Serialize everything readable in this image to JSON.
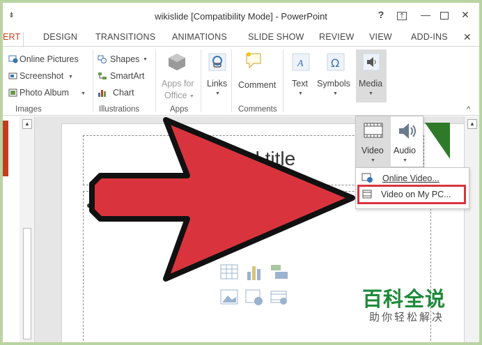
{
  "window": {
    "title": "wikislide [Compatibility Mode] - PowerPoint",
    "help": "?",
    "ribbon_options": "⤒",
    "minimize": "—",
    "close": "✕",
    "qat": "⇟"
  },
  "tabs": [
    "ERT",
    "DESIGN",
    "TRANSITIONS",
    "ANIMATIONS",
    "SLIDE SHOW",
    "REVIEW",
    "VIEW",
    "ADD-INS"
  ],
  "tab_close": "✕",
  "ribbon": {
    "images": {
      "online_pictures": "Online Pictures",
      "screenshot": "Screenshot",
      "photo_album": "Photo Album",
      "group": "Images"
    },
    "illustrations": {
      "shapes": "Shapes",
      "smartart": "SmartArt",
      "chart": "Chart",
      "group": "Illustrations"
    },
    "apps": {
      "apps_for_office_1": "Apps for",
      "apps_for_office_2": "Office",
      "group": "Apps"
    },
    "links": {
      "label": "Links"
    },
    "comments": {
      "comment": "Comment",
      "group": "Comments"
    },
    "text": {
      "label": "Text"
    },
    "symbols": {
      "label": "Symbols"
    },
    "media": {
      "label": "Media"
    },
    "collapse": "^"
  },
  "media_menu": {
    "video": "Video",
    "audio": "Audio",
    "online_video": "Online Video...",
    "video_on_pc": "Video on My PC..."
  },
  "slide": {
    "title_fragment": "ld title"
  },
  "watermark": {
    "title": "百科全说",
    "subtitle": "助你轻松解决"
  },
  "colors": {
    "accent": "#c43e1c",
    "highlight": "#d9343d",
    "arrow": "#d9343d",
    "watermark_green": "#1d8a3a",
    "frame_green": "#b9d3a3"
  }
}
